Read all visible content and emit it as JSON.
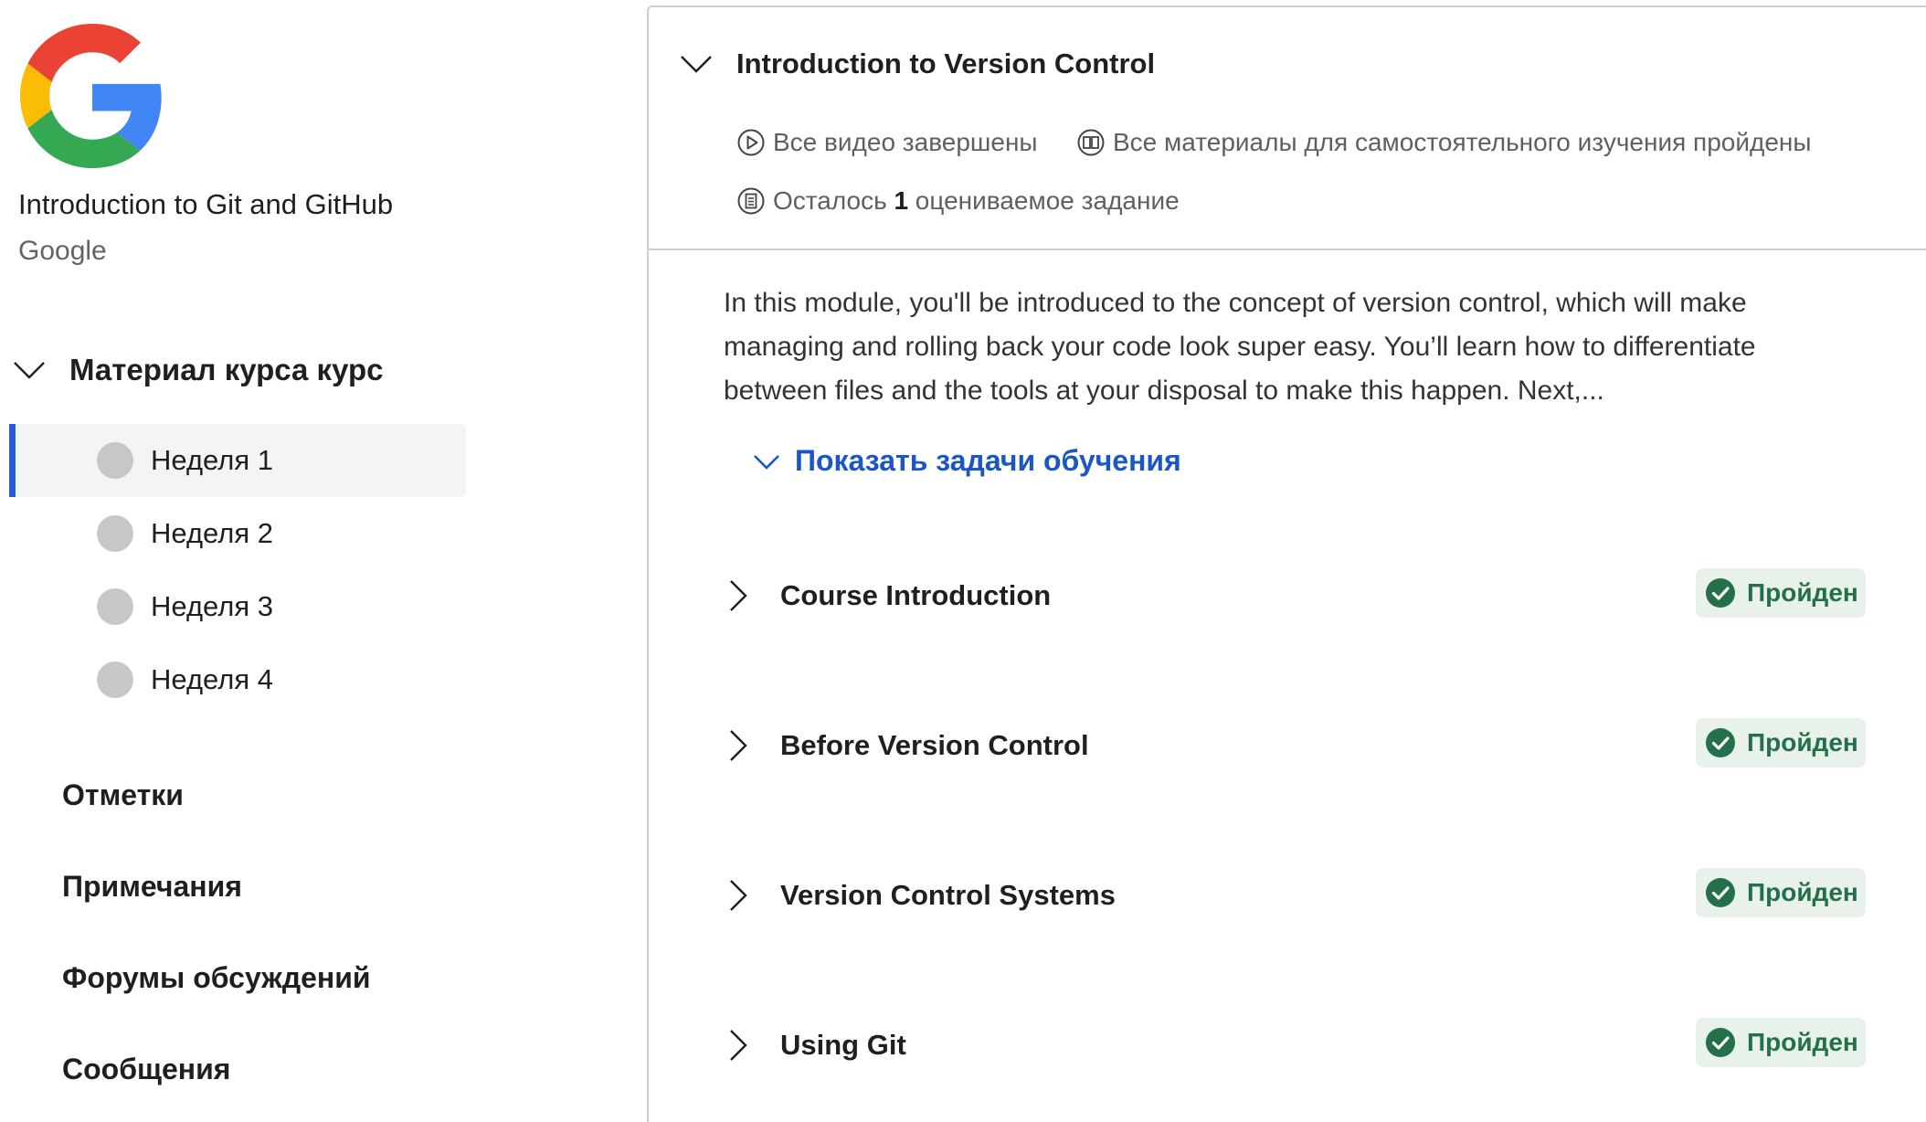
{
  "course": {
    "title": "Introduction to Git and GitHub",
    "org": "Google"
  },
  "sidebar": {
    "section_label": "Материал курса курс",
    "weeks": [
      {
        "label": "Неделя 1",
        "active": true
      },
      {
        "label": "Неделя 2",
        "active": false
      },
      {
        "label": "Неделя 3",
        "active": false
      },
      {
        "label": "Неделя 4",
        "active": false
      }
    ],
    "nav": [
      {
        "label": "Отметки"
      },
      {
        "label": "Примечания"
      },
      {
        "label": "Форумы обсуждений"
      },
      {
        "label": "Сообщения"
      }
    ]
  },
  "module": {
    "title": "Introduction to Version Control",
    "meta": {
      "videos": "Все видео завершены",
      "readings": "Все материалы для самостоятельного изучения пройдены",
      "graded_prefix": "Осталось ",
      "graded_count": "1",
      "graded_suffix": " оцениваемое задание"
    },
    "description": "In this module, you'll be introduced to the concept of version control, which will make managing and rolling back your code look super easy. You’ll learn how to differentiate between files and the tools at your disposal to make this happen. Next,...",
    "show_tasks_label": "Показать задачи обучения",
    "lessons": [
      {
        "title": "Course Introduction",
        "status": "Пройден"
      },
      {
        "title": "Before Version Control",
        "status": "Пройден"
      },
      {
        "title": "Version Control Systems",
        "status": "Пройден"
      },
      {
        "title": "Using Git",
        "status": "Пройден"
      }
    ]
  },
  "colors": {
    "accent_blue": "#1a56c4",
    "active_bar": "#2a5bd7",
    "badge_bg": "#e8f2ea",
    "badge_green": "#23704a"
  },
  "icons": {
    "logo": "google-g-logo",
    "video": "play-circle-icon",
    "reading": "book-circle-icon",
    "graded": "document-circle-icon",
    "check": "check-circle-icon"
  }
}
